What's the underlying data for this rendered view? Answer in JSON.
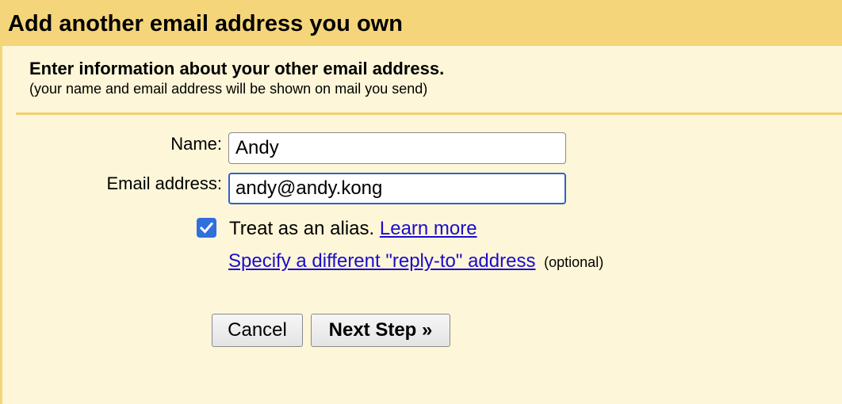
{
  "dialog": {
    "title": "Add another email address you own"
  },
  "intro": {
    "heading": "Enter information about your other email address.",
    "subtext": "(your name and email address will be shown on mail you send)"
  },
  "form": {
    "name_label": "Name:",
    "name_value": "Andy",
    "email_label": "Email address:",
    "email_value": "andy@andy.kong",
    "alias_checked": true,
    "alias_label": "Treat as an alias.",
    "learn_more": "Learn more",
    "reply_to_link": "Specify a different \"reply-to\" address",
    "optional": "(optional)"
  },
  "buttons": {
    "cancel": "Cancel",
    "next": "Next Step »"
  },
  "colors": {
    "header_bg": "#f5d57a",
    "panel_bg": "#fdf6d8",
    "link": "#1a0dcc",
    "focus_border": "#2f62c9",
    "checkbox": "#2f6fde"
  }
}
